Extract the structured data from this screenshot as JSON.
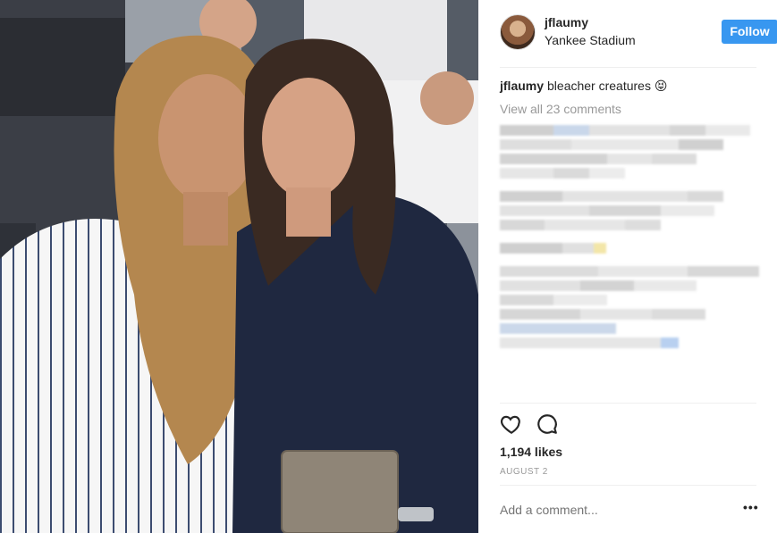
{
  "post": {
    "username": "jflaumy",
    "location": "Yankee Stadium",
    "follow_label": "Follow",
    "caption_user": "jflaumy",
    "caption_text": "bleacher creatures 😝",
    "view_all_label": "View all 23 comments",
    "likes_label": "1,194 likes",
    "date_label": "AUGUST 2",
    "add_comment_placeholder": "Add a comment...",
    "more_label": "•••"
  },
  "icons": {
    "like": "heart-icon",
    "comment": "comment-icon",
    "more": "more-options-icon"
  },
  "colors": {
    "accent": "#3897f0",
    "text": "#262626",
    "muted": "#999999",
    "divider": "#efefef"
  }
}
